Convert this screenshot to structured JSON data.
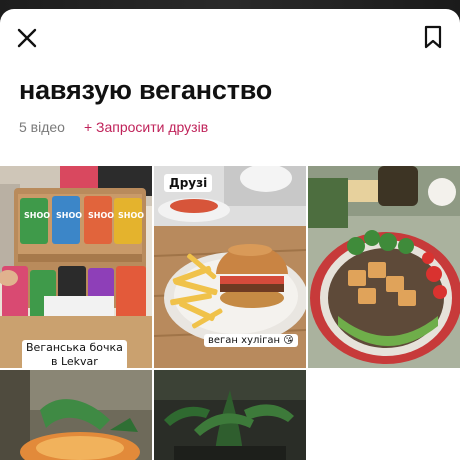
{
  "collection": {
    "title": "навязую веганство",
    "video_count": "5 відео",
    "invite_label": "+ Запросити друзів"
  },
  "toolbar": {
    "close_icon": "close-icon",
    "bookmark_icon": "bookmark-icon"
  },
  "colors": {
    "accent": "#c0235a",
    "muted_text": "#7a7a7a",
    "title_text": "#111111"
  },
  "videos": [
    {
      "caption_line1": "Веганська бочка",
      "caption_line2": "в Lekvar"
    },
    {
      "sticker": "Друзі",
      "caption": "веган хуліган 😘"
    },
    {
      "caption": ""
    },
    {
      "caption": ""
    },
    {
      "caption": ""
    }
  ]
}
